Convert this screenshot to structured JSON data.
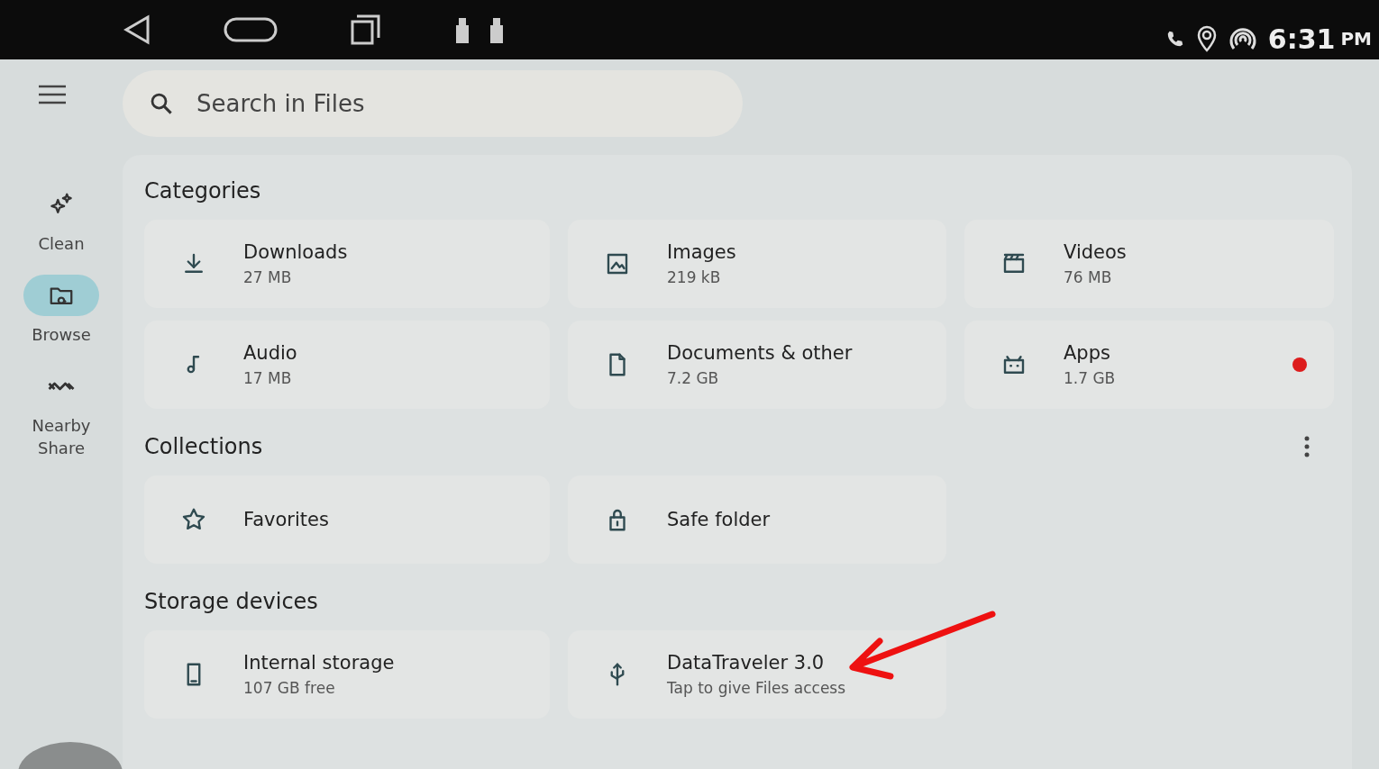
{
  "status_bar": {
    "time": "6:31",
    "ampm": "PM"
  },
  "nav_rail": [
    {
      "label": "Clean",
      "kind": "sparkle",
      "selected": false
    },
    {
      "label": "Browse",
      "kind": "browse",
      "selected": true
    },
    {
      "label": "Nearby Share",
      "kind": "nearby",
      "selected": false
    }
  ],
  "search": {
    "placeholder": "Search in Files"
  },
  "categories": {
    "title": "Categories",
    "items": [
      {
        "name": "Downloads",
        "detail": "27 MB",
        "kind": "download",
        "badge": false
      },
      {
        "name": "Images",
        "detail": "219 kB",
        "kind": "image",
        "badge": false
      },
      {
        "name": "Videos",
        "detail": "76 MB",
        "kind": "film",
        "badge": false
      },
      {
        "name": "Audio",
        "detail": "17 MB",
        "kind": "music",
        "badge": false
      },
      {
        "name": "Documents & other",
        "detail": "7.2 GB",
        "kind": "file",
        "badge": false
      },
      {
        "name": "Apps",
        "detail": "1.7 GB",
        "kind": "apps",
        "badge": true
      }
    ]
  },
  "collections": {
    "title": "Collections",
    "items": [
      {
        "name": "Favorites",
        "kind": "star"
      },
      {
        "name": "Safe folder",
        "kind": "lock"
      }
    ]
  },
  "storage": {
    "title": "Storage devices",
    "items": [
      {
        "name": "Internal storage",
        "detail": "107 GB free",
        "kind": "phone"
      },
      {
        "name": "DataTraveler 3.0",
        "detail": "Tap to give Files access",
        "kind": "usb"
      }
    ]
  }
}
